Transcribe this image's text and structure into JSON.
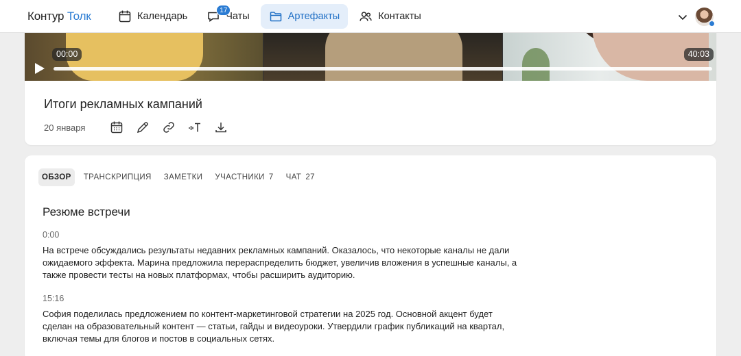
{
  "app": {
    "logo_main": "Контур",
    "logo_accent": "Толк"
  },
  "nav": [
    {
      "label": "Календарь",
      "icon": "calendar-icon"
    },
    {
      "label": "Чаты",
      "icon": "chat-icon",
      "badge": "17"
    },
    {
      "label": "Артефакты",
      "icon": "folder-icon",
      "active": true
    },
    {
      "label": "Контакты",
      "icon": "contacts-icon"
    }
  ],
  "video": {
    "current_time": "00:00",
    "duration": "40:03"
  },
  "meeting": {
    "title": "Итоги рекламных кампаний",
    "date": "20 января"
  },
  "tabs": [
    {
      "label": "ОБЗОР",
      "count": ""
    },
    {
      "label": "ТРАНСКРИПЦИЯ",
      "count": ""
    },
    {
      "label": "ЗАМЕТКИ",
      "count": ""
    },
    {
      "label": "УЧАСТНИКИ",
      "count": "7"
    },
    {
      "label": "ЧАТ",
      "count": "27"
    }
  ],
  "summary": {
    "title": "Резюме встречи",
    "segments": [
      {
        "time": "0:00",
        "text": "На встрече обсуждались результаты недавних рекламных кампаний. Оказалось, что некоторые каналы не дали ожидаемого эффекта. Марина предложила перераспределить бюджет, увеличив вложения в успешные каналы, а также провести тесты на новых платформах, чтобы расширить аудиторию."
      },
      {
        "time": "15:16",
        "text": "София поделилась предложением по контент-маркетинговой стратегии на 2025 год. Основной акцент будет сделан на образовательный контент — статьи, гайды и видеоуроки. Утвердили график публикаций на квартал, включая темы для блогов и постов в социальных сетях."
      }
    ]
  },
  "colors": {
    "accent": "#2b7cd3",
    "active_nav_bg": "#e4eefa",
    "page_bg": "#eeeeee"
  }
}
